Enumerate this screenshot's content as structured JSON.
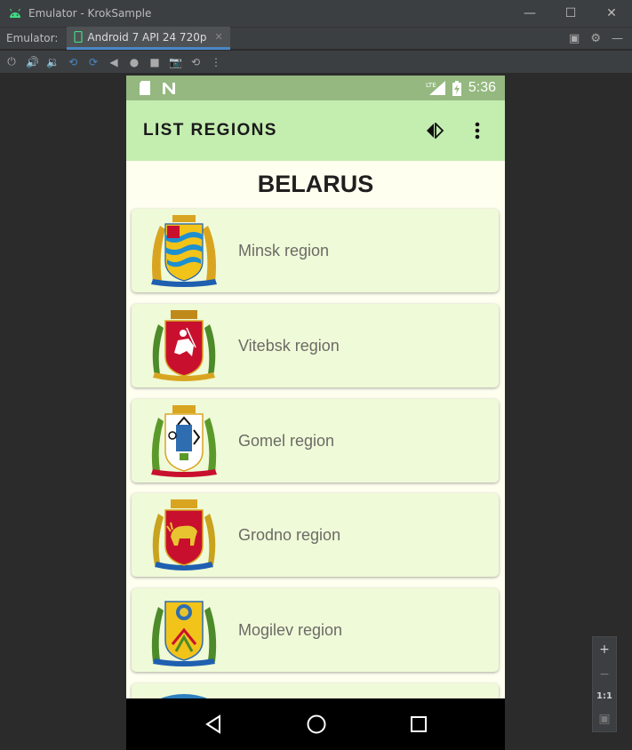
{
  "window": {
    "title": "Emulator - KrokSample",
    "minimize_icon": "minimize-icon",
    "maximize_icon": "maximize-icon",
    "close_icon": "close-icon"
  },
  "tabbar": {
    "label": "Emulator:",
    "tab_label": "Android 7 API 24 720p"
  },
  "toolbar": {
    "buttons": [
      "power-icon",
      "volume-up-icon",
      "volume-down-icon",
      "rotate-left-icon",
      "rotate-right-icon",
      "back-icon",
      "home-icon",
      "overview-icon",
      "screenshot-icon",
      "snapshot-icon",
      "more-icon"
    ]
  },
  "status_bar": {
    "time": "5:36",
    "network": "LTE"
  },
  "app_bar": {
    "title": "LIST REGIONS",
    "colors": {
      "status": "#94b87f",
      "app_bar": "#c4edb0",
      "card": "#effad8",
      "background": "#fffff0"
    }
  },
  "country": "BELARUS",
  "regions": [
    {
      "name": "Minsk region",
      "emblem": "minsk-coat-of-arms"
    },
    {
      "name": "Vitebsk region",
      "emblem": "vitebsk-coat-of-arms"
    },
    {
      "name": "Gomel region",
      "emblem": "gomel-coat-of-arms"
    },
    {
      "name": "Grodno region",
      "emblem": "grodno-coat-of-arms"
    },
    {
      "name": "Mogilev region",
      "emblem": "mogilev-coat-of-arms"
    }
  ],
  "zoom_panel": {
    "zoom_in": "+",
    "zoom_out": "−",
    "actual_size": "1:1"
  }
}
